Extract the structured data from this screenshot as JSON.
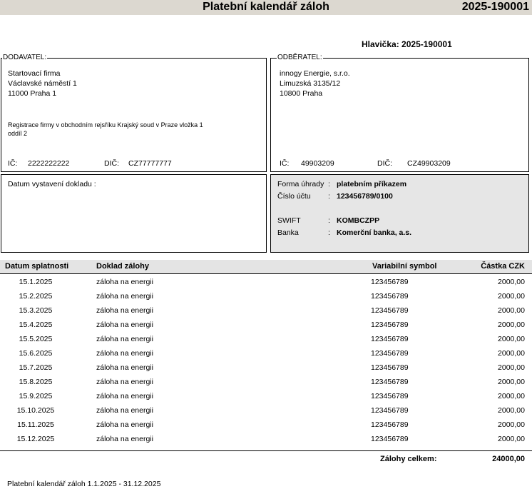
{
  "header": {
    "title": "Platební kalendář záloh",
    "doc_number": "2025-190001",
    "hlavicka_label": "Hlavička:",
    "hlavicka_value": "2025-190001"
  },
  "supplier": {
    "legend": "DODAVATEL:",
    "name": "Startovací firma",
    "street": "Václavské náměstí 1",
    "city": "11000 Praha 1",
    "registration_1": "Registrace firmy v obchodním rejsříku Krajský soud v Praze vložka 1",
    "registration_2": "oddíl 2",
    "ic_label": "IČ:",
    "ic": "2222222222",
    "dic_label": "DIČ:",
    "dic": "CZ77777777"
  },
  "customer": {
    "legend": "ODBĚRATEL:",
    "name": "innogy Energie, s.r.o.",
    "street": "Limuzská 3135/12",
    "city": "10800 Praha",
    "ic_label": "IČ:",
    "ic": "49903209",
    "dic_label": "DIČ:",
    "dic": "CZ49903209"
  },
  "issue": {
    "label": "Datum vystavení dokladu :"
  },
  "payment": {
    "method_label": "Forma úhrady",
    "method": "platebním příkazem",
    "account_label": "Číslo účtu",
    "account": "123456789/0100",
    "swift_label": "SWIFT",
    "swift": "KOMBCZPP",
    "bank_label": "Banka",
    "bank": "Komerční banka, a.s.",
    "colon": ":"
  },
  "table": {
    "headers": [
      "Datum splatnosti",
      "Doklad zálohy",
      "Variabilní symbol",
      "Částka CZK"
    ],
    "rows": [
      [
        "15.1.2025",
        "záloha na energii",
        "123456789",
        "2000,00"
      ],
      [
        "15.2.2025",
        "záloha na energii",
        "123456789",
        "2000,00"
      ],
      [
        "15.3.2025",
        "záloha na energii",
        "123456789",
        "2000,00"
      ],
      [
        "15.4.2025",
        "záloha na energii",
        "123456789",
        "2000,00"
      ],
      [
        "15.5.2025",
        "záloha na energii",
        "123456789",
        "2000,00"
      ],
      [
        "15.6.2025",
        "záloha na energii",
        "123456789",
        "2000,00"
      ],
      [
        "15.7.2025",
        "záloha na energii",
        "123456789",
        "2000,00"
      ],
      [
        "15.8.2025",
        "záloha na energii",
        "123456789",
        "2000,00"
      ],
      [
        "15.9.2025",
        "záloha na energii",
        "123456789",
        "2000,00"
      ],
      [
        "15.10.2025",
        "záloha na energii",
        "123456789",
        "2000,00"
      ],
      [
        "15.11.2025",
        "záloha na energii",
        "123456789",
        "2000,00"
      ],
      [
        "15.12.2025",
        "záloha na energii",
        "123456789",
        "2000,00"
      ]
    ],
    "total_label": "Zálohy celkem:",
    "total": "24000,00"
  },
  "footer": {
    "text": "Platební kalendář záloh 1.1.2025 - 31.12.2025"
  }
}
